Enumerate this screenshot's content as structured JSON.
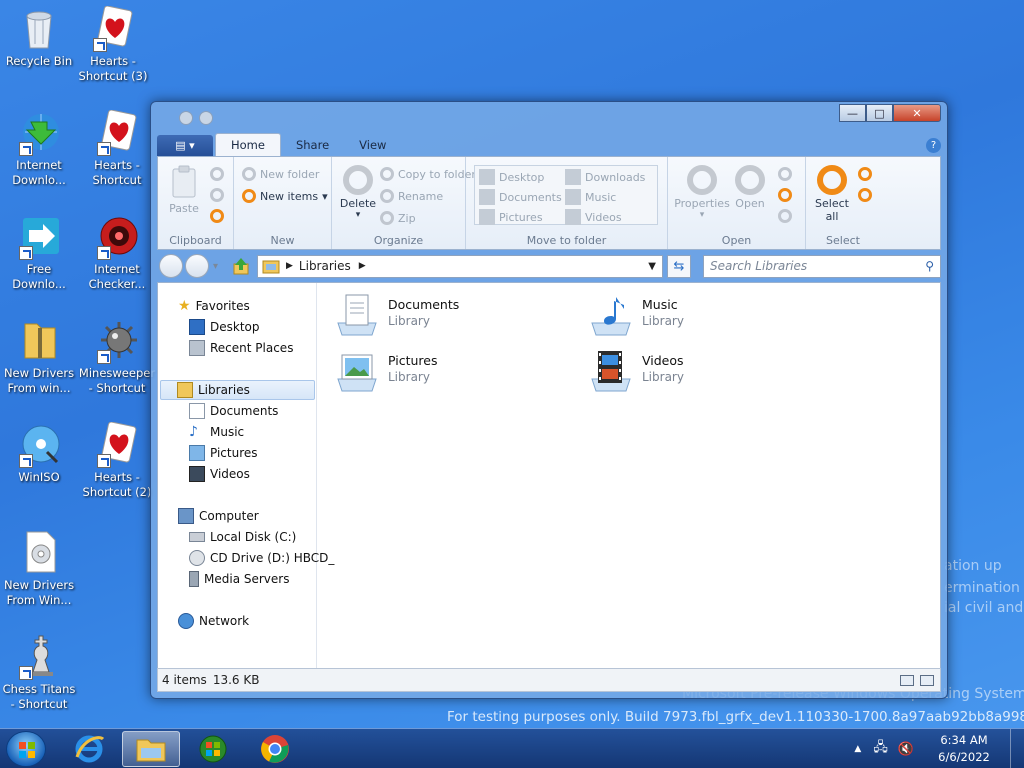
{
  "desktop": {
    "icons": [
      {
        "label": "Recycle Bin"
      },
      {
        "label": "Hearts - Shortcut (3)"
      },
      {
        "label": "Internet Downlo..."
      },
      {
        "label": "Hearts - Shortcut"
      },
      {
        "label": "Free Downlo..."
      },
      {
        "label": "Internet Checker..."
      },
      {
        "label": "New Drivers From win..."
      },
      {
        "label": "Minesweeper - Shortcut"
      },
      {
        "label": "WinISO"
      },
      {
        "label": "Hearts - Shortcut (2)"
      },
      {
        "label": "New Drivers From Win..."
      },
      {
        "label": "Chess Titans - Shortcut"
      }
    ],
    "watermark": {
      "fragments": [
        "ation up",
        "ermination",
        "ial civil and"
      ],
      "os_line": "Microsoft Pre-release Windows Operating System",
      "build_line": "For testing purposes only. Build 7973.fbl_grfx_dev1.110330-1700.8a97aab92bb8a998"
    }
  },
  "window": {
    "close_glyph": "✕",
    "min_glyph": "—",
    "max_glyph": "□",
    "tabs": {
      "home": "Home",
      "share": "Share",
      "view": "View"
    },
    "help_glyph": "?",
    "ribbon": {
      "clipboard": {
        "paste": "Paste",
        "label": "Clipboard"
      },
      "new": {
        "new_folder": "New folder",
        "new_items": "New items",
        "label": "New"
      },
      "organize": {
        "delete": "Delete",
        "copy_to_folder": "Copy to folder",
        "rename": "Rename",
        "zip": "Zip",
        "label": "Organize"
      },
      "move_to": {
        "items": [
          "Desktop",
          "Downloads",
          "Documents",
          "Music",
          "Pictures",
          "Videos"
        ],
        "label": "Move to folder"
      },
      "open": {
        "properties": "Properties",
        "open": "Open",
        "label": "Open"
      },
      "select": {
        "select_all_line1": "Select",
        "select_all_line2": "all",
        "label": "Select"
      }
    },
    "address": {
      "path": "Libraries",
      "search_placeholder": "Search Libraries"
    },
    "nav": {
      "favorites": "Favorites",
      "desktop": "Desktop",
      "recent_places": "Recent Places",
      "libraries": "Libraries",
      "documents": "Documents",
      "music": "Music",
      "pictures": "Pictures",
      "videos": "Videos",
      "computer": "Computer",
      "local_disk": "Local Disk (C:)",
      "cd_drive": "CD Drive (D:) HBCD_",
      "media_servers": "Media Servers",
      "network": "Network"
    },
    "libraries": [
      {
        "name": "Documents",
        "type": "Library"
      },
      {
        "name": "Music",
        "type": "Library"
      },
      {
        "name": "Pictures",
        "type": "Library"
      },
      {
        "name": "Videos",
        "type": "Library"
      }
    ],
    "status": {
      "items": "4 items",
      "size": "13.6 KB"
    }
  },
  "taskbar": {
    "time": "6:34 AM",
    "date": "6/6/2022"
  },
  "colors": {
    "accent": "#f08a16",
    "selection": "#d6e6f8"
  }
}
